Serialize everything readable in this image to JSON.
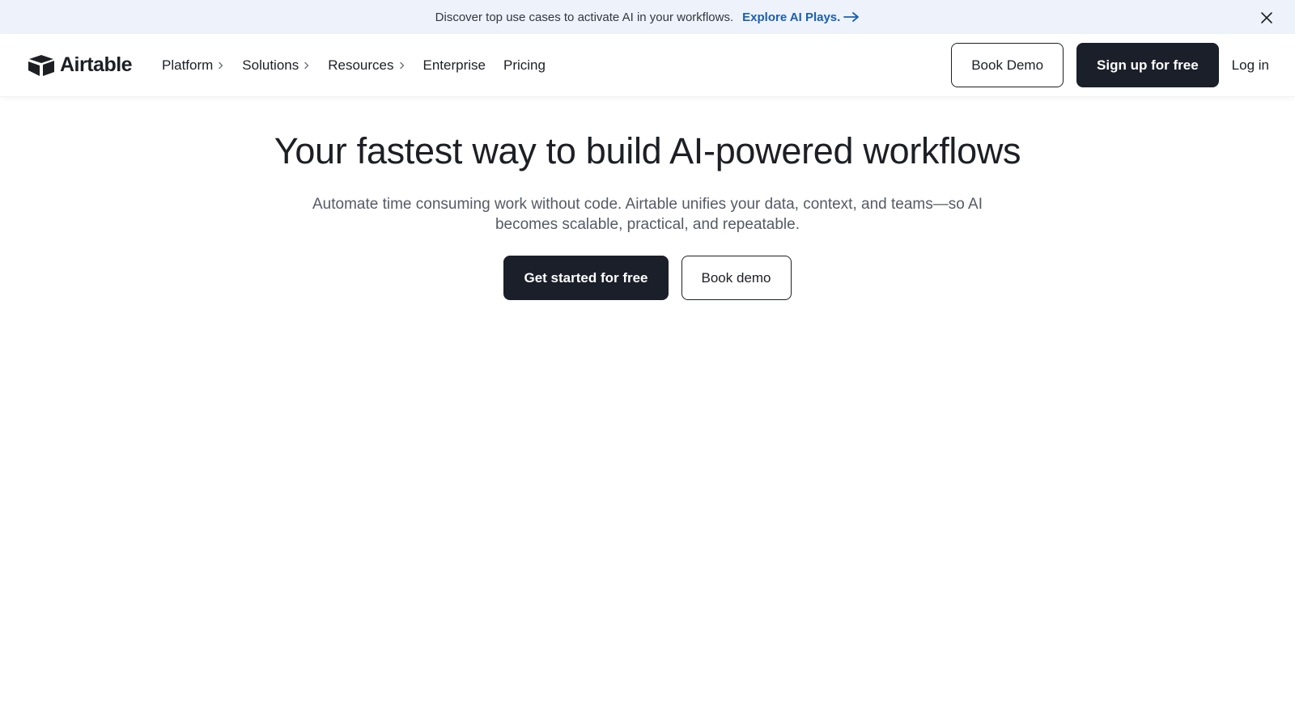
{
  "banner": {
    "text": "Discover top use cases to activate AI in your workflows.",
    "link_label": "Explore AI Plays.",
    "link_icon": "arrow-right-icon",
    "close_icon": "close-icon"
  },
  "header": {
    "logo": {
      "icon": "airtable-logo-icon",
      "label": "Airtable"
    },
    "nav": [
      {
        "label": "Platform",
        "has_chevron": true
      },
      {
        "label": "Solutions",
        "has_chevron": true
      },
      {
        "label": "Resources",
        "has_chevron": true
      },
      {
        "label": "Enterprise",
        "has_chevron": false
      },
      {
        "label": "Pricing",
        "has_chevron": false
      }
    ],
    "actions": {
      "book_demo_label": "Book Demo",
      "signup_label": "Sign up for free",
      "login_label": "Log in"
    }
  },
  "hero": {
    "title": "Your fastest way to build AI-powered workflows",
    "subtitle": "Automate time consuming work without code. Airtable unifies your data, context, and teams—so AI becomes scalable, practical, and repeatable.",
    "primary_cta": "Get started for free",
    "secondary_cta": "Book demo"
  },
  "colors": {
    "banner_bg": "#eef3fb",
    "link_blue": "#1b5fb0",
    "dark_button": "#1b1f2a",
    "text_primary": "#1d1f25",
    "text_secondary": "#555a66"
  }
}
